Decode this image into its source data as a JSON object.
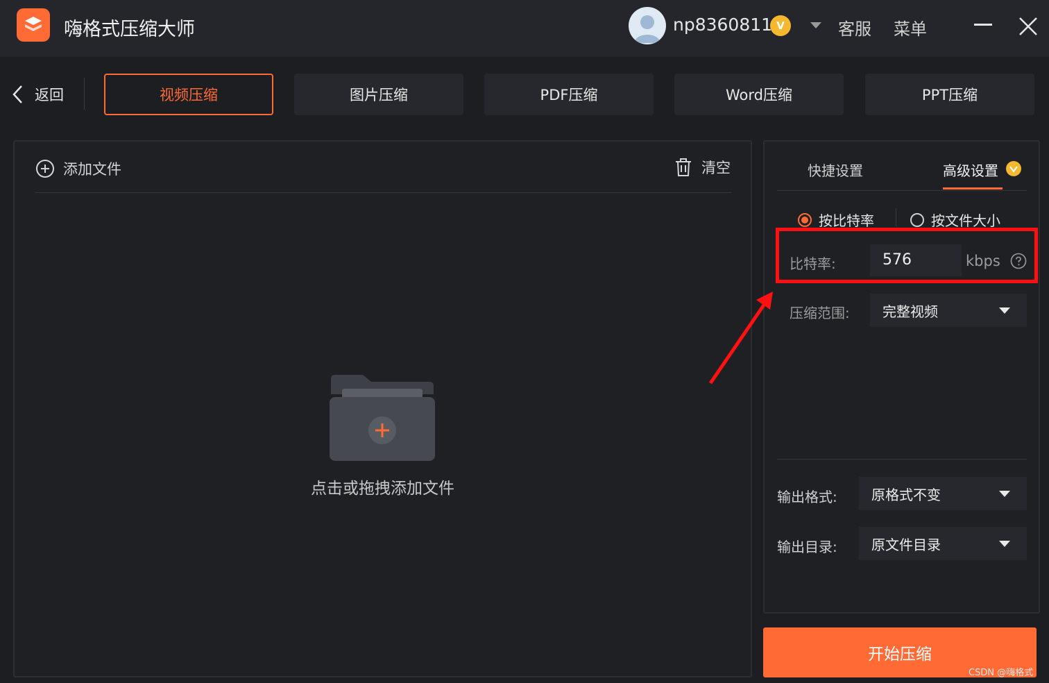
{
  "app": {
    "title": "嗨格式压缩大师",
    "username": "np8360811",
    "vip_badge": "V",
    "service_label": "客服",
    "menu_label": "菜单"
  },
  "nav": {
    "back_label": "返回",
    "tabs": [
      {
        "label": "视频压缩",
        "active": true
      },
      {
        "label": "图片压缩",
        "active": false
      },
      {
        "label": "PDF压缩",
        "active": false
      },
      {
        "label": "Word压缩",
        "active": false
      },
      {
        "label": "PPT压缩",
        "active": false
      }
    ]
  },
  "file_panel": {
    "add_file_label": "添加文件",
    "clear_label": "清空",
    "drop_hint": "点击或拖拽添加文件"
  },
  "settings": {
    "tabs": {
      "quick": "快捷设置",
      "advanced": "高级设置"
    },
    "active_tab": "advanced",
    "mode_options": [
      {
        "label": "按比特率",
        "checked": true
      },
      {
        "label": "按文件大小",
        "checked": false
      }
    ],
    "bitrate": {
      "label": "比特率:",
      "value": "576",
      "unit": "kbps"
    },
    "range": {
      "label": "压缩范围:",
      "value": "完整视频"
    },
    "output_format": {
      "label": "输出格式:",
      "value": "原格式不变"
    },
    "output_dir": {
      "label": "输出目录:",
      "value": "原文件目录"
    }
  },
  "start_button_label": "开始压缩",
  "watermark": "CSDN @嗨格式",
  "colors": {
    "accent": "#ff6a35",
    "background": "#1c1e22",
    "annotation": "#ff1111",
    "vip": "#f5b82e"
  }
}
